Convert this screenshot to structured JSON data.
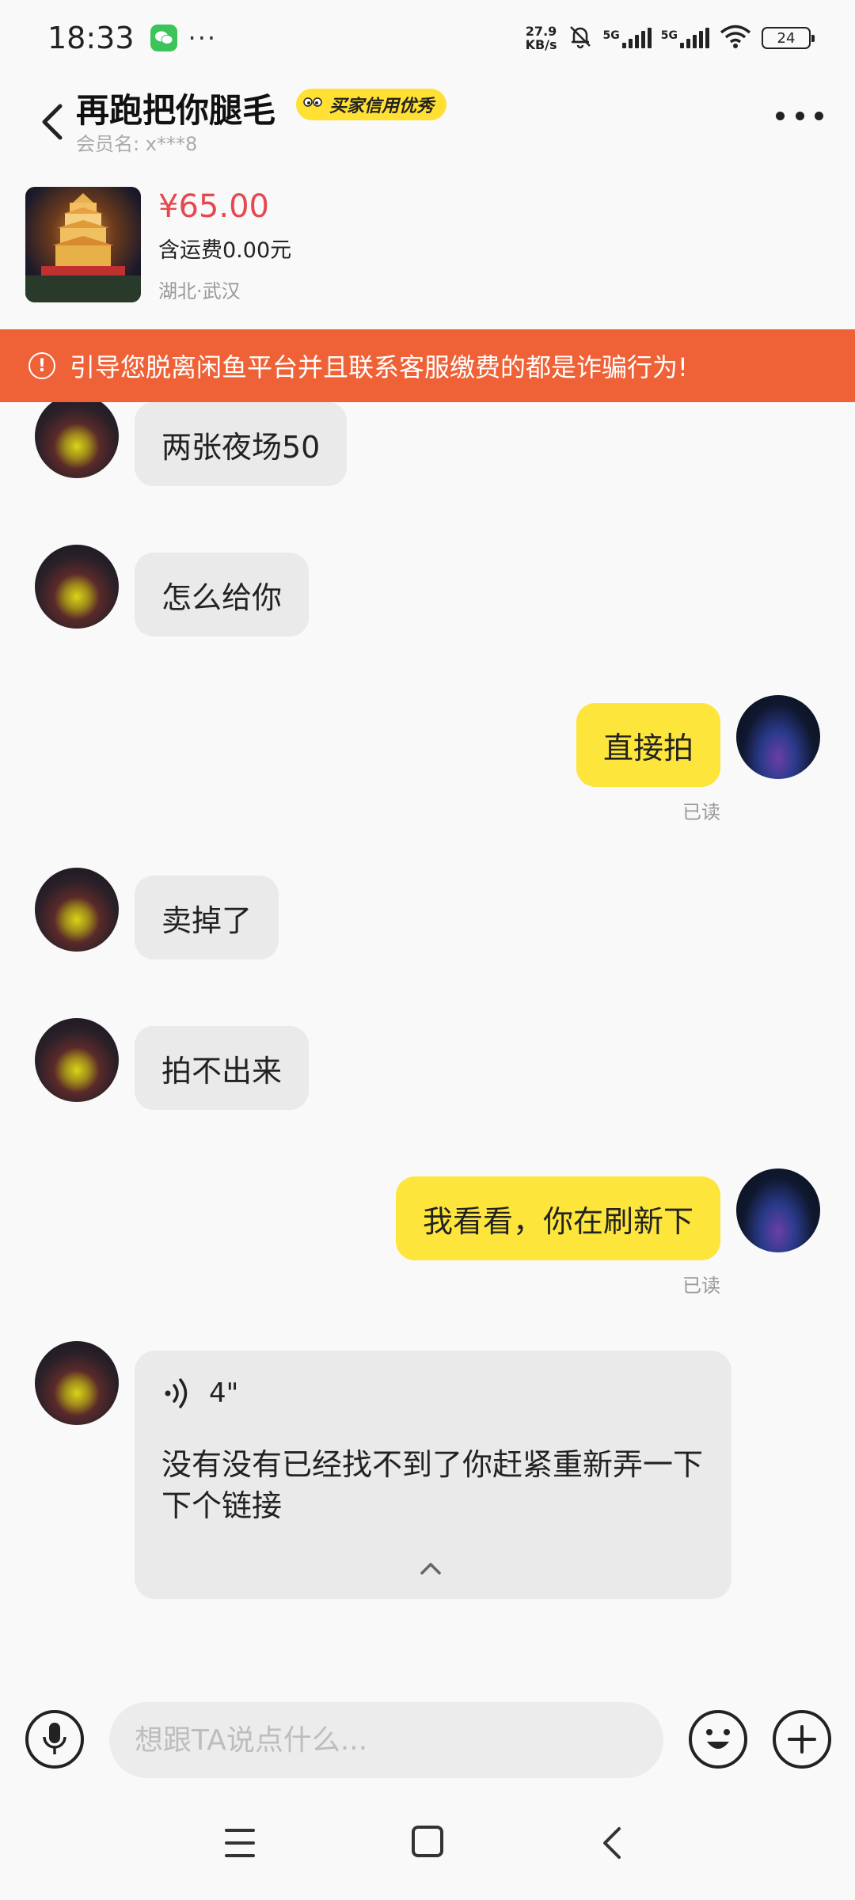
{
  "status_bar": {
    "time": "18:33",
    "dots": "···",
    "net_speed_value": "27.9",
    "net_speed_unit": "KB/s",
    "signal1_label": "5G",
    "signal2_label": "5G",
    "battery": "24",
    "icons": [
      "wechat-icon",
      "mute-bell-icon",
      "signal-icon",
      "wifi-icon",
      "battery-icon"
    ]
  },
  "header": {
    "seller_name": "再跑把你腿毛",
    "credit_badge": "买家信用优秀",
    "member_label": "会员名:",
    "member_value": "x***8"
  },
  "product": {
    "price": "¥65.00",
    "shipping": "含运费0.00元",
    "location": "湖北·武汉"
  },
  "warning": {
    "text": "引导您脱离闲鱼平台并且联系客服缴费的都是诈骗行为!"
  },
  "messages": [
    {
      "from": "them",
      "text": "两张夜场50"
    },
    {
      "from": "them",
      "text": "怎么给你"
    },
    {
      "from": "me",
      "text": "直接拍",
      "status": "已读"
    },
    {
      "from": "them",
      "text": "卖掉了"
    },
    {
      "from": "them",
      "text": "拍不出来"
    },
    {
      "from": "me",
      "text": "我看看，你在刷新下",
      "status": "已读"
    },
    {
      "from": "them",
      "type": "voice",
      "duration": "4\"",
      "transcript": "没有没有已经找不到了你赶紧重新弄一下下个链接"
    }
  ],
  "input": {
    "placeholder": "想跟TA说点什么..."
  },
  "colors": {
    "accent_yellow": "#fde53c",
    "warning_orange": "#ef6237",
    "price_red": "#e5484d",
    "bubble_gray": "#eaeaea"
  }
}
